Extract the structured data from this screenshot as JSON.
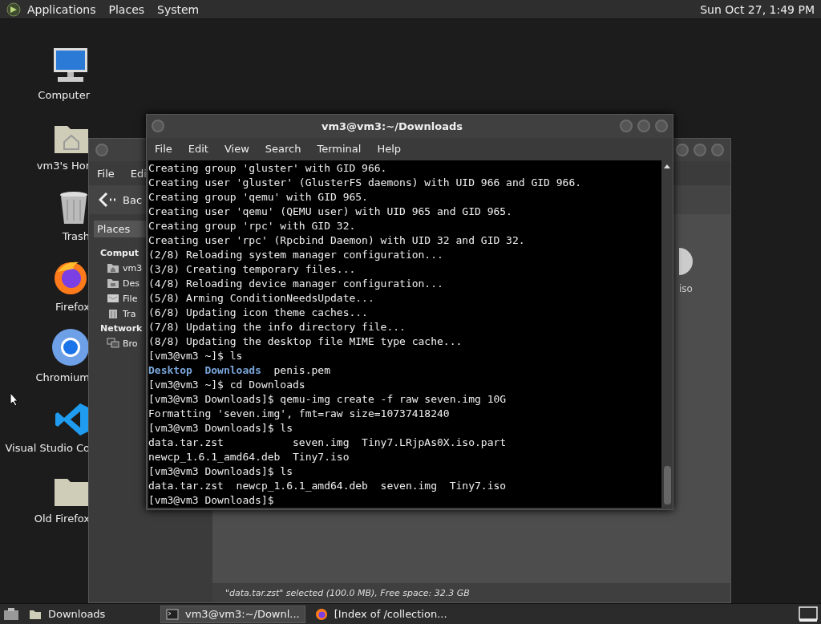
{
  "top_panel": {
    "menus": [
      "Applications",
      "Places",
      "System"
    ],
    "clock": "Sun Oct 27, 1:49 PM"
  },
  "desktop_icons": [
    {
      "label": "Computer",
      "kind": "computer"
    },
    {
      "label": "vm3's Hor",
      "kind": "home"
    },
    {
      "label": "Trash",
      "kind": "trash"
    },
    {
      "label": "Firefox",
      "kind": "firefox"
    },
    {
      "label": "Chromium",
      "kind": "chromium"
    },
    {
      "label": "Visual Studio Co",
      "kind": "vscode"
    },
    {
      "label": "Old Firefox",
      "kind": "folder"
    }
  ],
  "file_manager": {
    "menu": [
      "File",
      "Edi"
    ],
    "back_label": "Bac",
    "places_dropdown": "Places",
    "sidebar": [
      {
        "heading": "Comput",
        "items": [
          {
            "label": "vm3",
            "kind": "home"
          },
          {
            "label": "Des",
            "kind": "desktop"
          },
          {
            "label": "File",
            "kind": "filesystem"
          },
          {
            "label": "Tra",
            "kind": "trash"
          }
        ]
      },
      {
        "heading": "Network",
        "items": [
          {
            "label": "Bro",
            "kind": "network"
          }
        ]
      }
    ],
    "files": [
      {
        "name": "iso"
      }
    ],
    "status": "\"data.tar.zst\" selected (100.0 MB), Free space: 32.3 GB"
  },
  "terminal": {
    "title": "vm3@vm3:~/Downloads",
    "menu": [
      "File",
      "Edit",
      "View",
      "Search",
      "Terminal",
      "Help"
    ],
    "lines": [
      {
        "text": "Creating group 'gluster' with GID 966."
      },
      {
        "text": "Creating user 'gluster' (GlusterFS daemons) with UID 966 and GID 966."
      },
      {
        "text": "Creating group 'qemu' with GID 965."
      },
      {
        "text": "Creating user 'qemu' (QEMU user) with UID 965 and GID 965."
      },
      {
        "text": "Creating group 'rpc' with GID 32."
      },
      {
        "text": "Creating user 'rpc' (Rpcbind Daemon) with UID 32 and GID 32."
      },
      {
        "text": "(2/8) Reloading system manager configuration..."
      },
      {
        "text": "(3/8) Creating temporary files..."
      },
      {
        "text": "(4/8) Reloading device manager configuration..."
      },
      {
        "text": "(5/8) Arming ConditionNeedsUpdate..."
      },
      {
        "text": "(6/8) Updating icon theme caches..."
      },
      {
        "text": "(7/8) Updating the info directory file..."
      },
      {
        "text": "(8/8) Updating the desktop file MIME type cache..."
      },
      {
        "text": "[vm3@vm3 ~]$ ls"
      },
      {
        "parts": [
          {
            "text": "Desktop",
            "kind": "directory"
          },
          {
            "text": "Downloads",
            "kind": "directory"
          },
          {
            "text": "penis.pem",
            "kind": "file"
          }
        ]
      },
      {
        "text": "[vm3@vm3 ~]$ cd Downloads"
      },
      {
        "text": "[vm3@vm3 Downloads]$ qemu-img create -f raw seven.img 10G"
      },
      {
        "text": "Formatting 'seven.img', fmt=raw size=10737418240"
      },
      {
        "text": "[vm3@vm3 Downloads]$ ls"
      },
      {
        "text": "data.tar.zst           seven.img  Tiny7.LRjpAs0X.iso.part"
      },
      {
        "text": "newcp_1.6.1_amd64.deb  Tiny7.iso"
      },
      {
        "text": "[vm3@vm3 Downloads]$ ls"
      },
      {
        "text": "data.tar.zst  newcp_1.6.1_amd64.deb  seven.img  Tiny7.iso"
      },
      {
        "text": "[vm3@vm3 Downloads]$"
      }
    ]
  },
  "taskbar": {
    "tasks": [
      {
        "label": "Downloads",
        "kind": "folder",
        "selected": false
      },
      {
        "label": "vm3@vm3:~/Downl...",
        "kind": "terminal",
        "selected": true
      },
      {
        "label": "[Index of /collection...",
        "kind": "browser",
        "selected": false
      }
    ]
  }
}
